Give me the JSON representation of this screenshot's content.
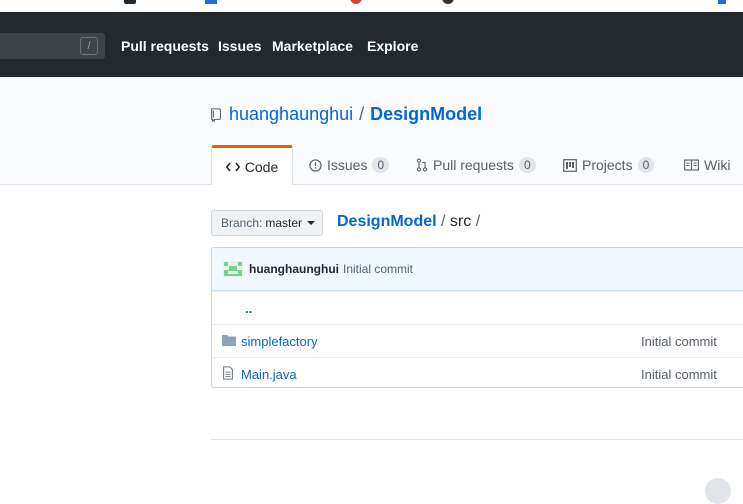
{
  "header": {
    "search_shortcut": "/",
    "nav": [
      "Pull requests",
      "Issues",
      "Marketplace",
      "Explore"
    ]
  },
  "repo": {
    "owner": "huanghaunghui",
    "separator": "/",
    "name": "DesignModel"
  },
  "tabs": [
    {
      "label": "Code",
      "count": null,
      "icon": "code-icon"
    },
    {
      "label": "Issues",
      "count": "0",
      "icon": "issue-icon"
    },
    {
      "label": "Pull requests",
      "count": "0",
      "icon": "pull-request-icon"
    },
    {
      "label": "Projects",
      "count": "0",
      "icon": "project-icon"
    },
    {
      "label": "Wiki",
      "count": null,
      "icon": "book-icon"
    }
  ],
  "branch": {
    "label": "Branch:",
    "value": "master"
  },
  "breadcrumb": {
    "root": "DesignModel",
    "sep1": "/",
    "current": "src",
    "sep2": "/"
  },
  "commit": {
    "author": "huanghaunghui",
    "message": "Initial commit"
  },
  "files": {
    "parent": "..",
    "items": [
      {
        "type": "directory",
        "name": "simplefactory",
        "message": "Initial commit"
      },
      {
        "type": "file",
        "name": "Main.java",
        "message": "Initial commit"
      }
    ]
  },
  "colors": {
    "header_bg": "#24292e",
    "link": "#0366d6",
    "selected_tab_accent": "#e36209"
  }
}
